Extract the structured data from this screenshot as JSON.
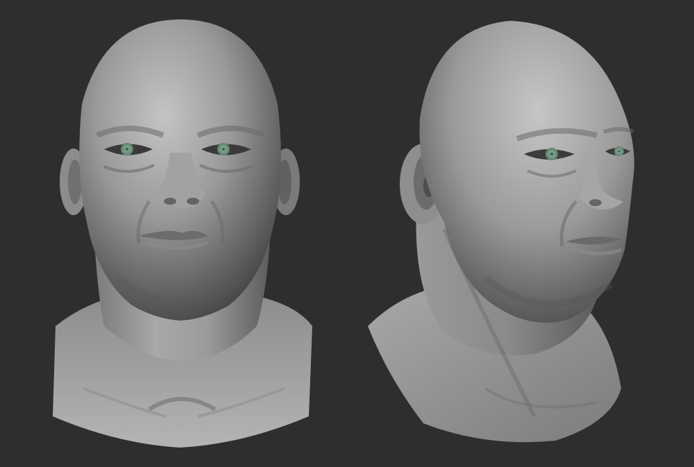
{
  "scene": {
    "background_color": "#2e2e2e",
    "clay_light": "#b9b9b9",
    "clay_mid": "#8a8a8a",
    "clay_dark": "#4a4a4a",
    "iris_color": "#7fa58f",
    "views": [
      {
        "view": "front"
      },
      {
        "view": "three-quarter"
      }
    ]
  }
}
